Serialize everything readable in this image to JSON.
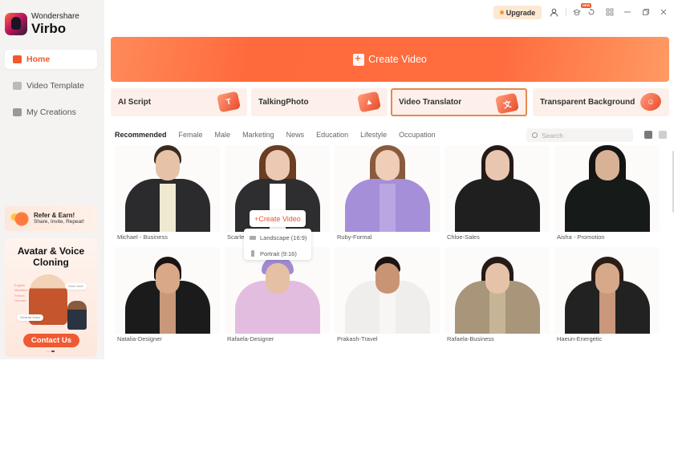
{
  "app": {
    "brand": "Wondershare",
    "product": "Virbo"
  },
  "topbar": {
    "upgrade_label": "Upgrade",
    "new_badge": "NEW",
    "icons": [
      "account-icon",
      "learn-icon",
      "history-icon",
      "apps-grid-icon",
      "minimize-icon",
      "restore-icon",
      "close-icon"
    ]
  },
  "sidebar": {
    "items": [
      {
        "label": "Home",
        "icon": "home-icon",
        "active": true
      },
      {
        "label": "Video Template",
        "icon": "video-template-icon",
        "active": false
      },
      {
        "label": "My Creations",
        "icon": "my-creations-icon",
        "active": false
      }
    ],
    "refer": {
      "title": "Refer & Earn!",
      "subtitle": "Share, Invite, Repeat!"
    },
    "promo": {
      "title": "Avatar & Voice Cloning",
      "button": "Contact Us",
      "chips": [
        "Clone Voice",
        "Generate Avatar"
      ],
      "languages": "English\nMandarin\nFrench\nGerman"
    }
  },
  "main": {
    "hero_button": "Create Video",
    "features": [
      {
        "label": "AI Script",
        "icon": "ai-script-icon",
        "glyph": "T",
        "selected": false
      },
      {
        "label": "TalkingPhoto",
        "icon": "talking-photo-icon",
        "glyph": "▲",
        "selected": false
      },
      {
        "label": "Video Translator",
        "icon": "video-translator-icon",
        "glyph": "文",
        "selected": true
      },
      {
        "label": "Transparent Background",
        "icon": "transparent-background-icon",
        "glyph": "☺",
        "selected": false
      }
    ],
    "tabs": [
      "Recommended",
      "Female",
      "Male",
      "Marketing",
      "News",
      "Education",
      "Lifestyle",
      "Occupation"
    ],
    "active_tab": "Recommended",
    "search_placeholder": "Search",
    "avatars": [
      {
        "name": "Michael - Business"
      },
      {
        "name": "Scarlett"
      },
      {
        "name": "Ruby-Formal"
      },
      {
        "name": "Chloe-Sales"
      },
      {
        "name": "Aisha - Promotion"
      },
      {
        "name": "Natalia-Designer"
      },
      {
        "name": "Rafaela-Designer"
      },
      {
        "name": "Prakash-Travel"
      },
      {
        "name": "Rafaela-Business"
      },
      {
        "name": "Haeun-Energetic"
      }
    ],
    "popup": {
      "create_button": "+Create Video",
      "options": [
        "Landscape (16:9)",
        "Portrait (9:16)"
      ]
    }
  }
}
